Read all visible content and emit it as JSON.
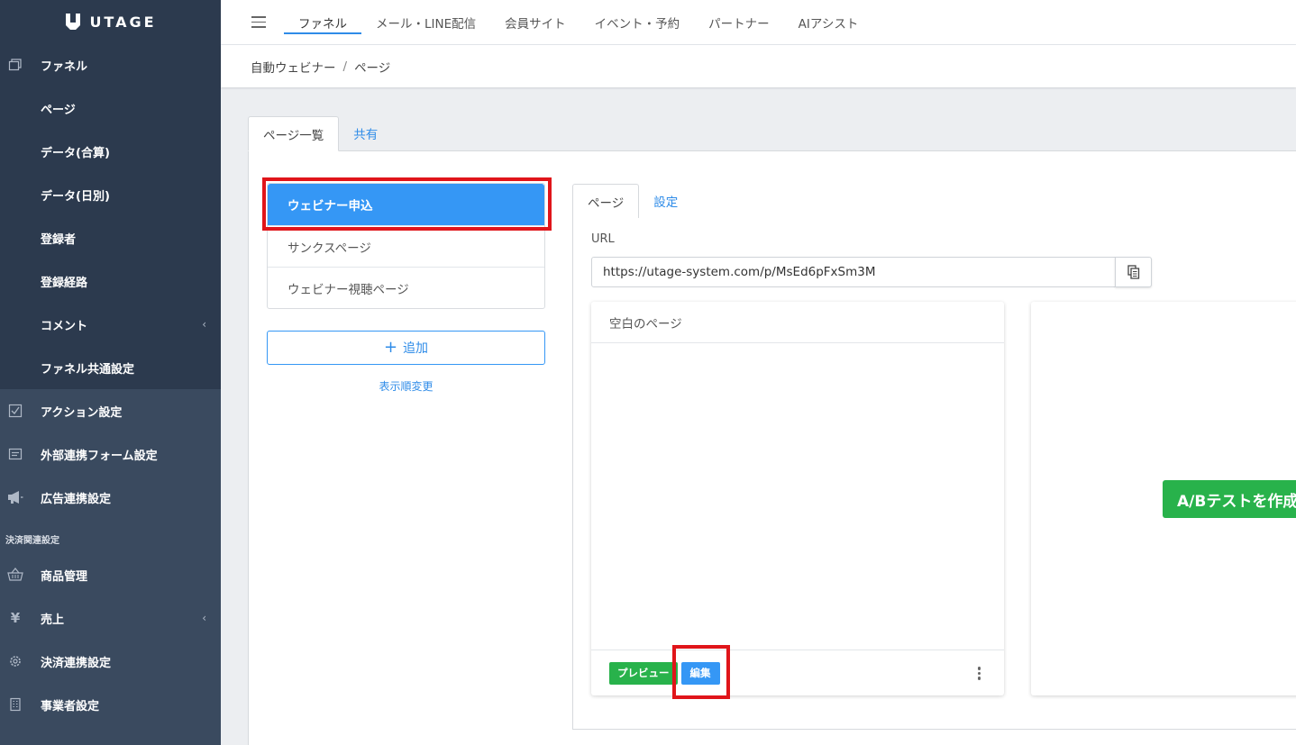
{
  "brand": {
    "name": "UTAGE"
  },
  "sidebar": {
    "funnel_items": [
      {
        "label": "ファネル",
        "icon": "funnel-icon"
      },
      {
        "label": "ページ"
      },
      {
        "label": "データ(合算)"
      },
      {
        "label": "データ(日別)"
      },
      {
        "label": "登録者"
      },
      {
        "label": "登録経路"
      },
      {
        "label": "コメント",
        "chevron": "‹"
      },
      {
        "label": "ファネル共通設定"
      }
    ],
    "items": [
      {
        "label": "アクション設定",
        "icon": "checklist-icon"
      },
      {
        "label": "外部連携フォーム設定",
        "icon": "form-icon"
      },
      {
        "label": "広告連携設定",
        "icon": "megaphone-icon"
      }
    ],
    "section_payment": "決済関連設定",
    "payment_items": [
      {
        "label": "商品管理",
        "icon": "basket-icon"
      },
      {
        "label": "売上",
        "icon": "yen-icon",
        "chevron": "‹"
      },
      {
        "label": "決済連携設定",
        "icon": "gear-icon"
      },
      {
        "label": "事業者設定",
        "icon": "building-icon"
      }
    ]
  },
  "topnav": {
    "items": [
      {
        "label": "ファネル",
        "active": true
      },
      {
        "label": "メール・LINE配信"
      },
      {
        "label": "会員サイト"
      },
      {
        "label": "イベント・予約"
      },
      {
        "label": "パートナー"
      },
      {
        "label": "AIアシスト"
      }
    ]
  },
  "breadcrumb": {
    "parent": "自動ウェビナー",
    "sep": "/",
    "current": "ページ"
  },
  "main_tabs": [
    {
      "label": "ページ一覧",
      "active": true
    },
    {
      "label": "共有"
    }
  ],
  "page_list": {
    "items": [
      {
        "label": "ウェビナー申込",
        "active": true
      },
      {
        "label": "サンクスページ"
      },
      {
        "label": "ウェビナー視聴ページ"
      }
    ],
    "add_label": "追加",
    "reorder_label": "表示順変更"
  },
  "page_tabs": [
    {
      "label": "ページ",
      "active": true
    },
    {
      "label": "設定"
    }
  ],
  "url": {
    "label": "URL",
    "value": "https://utage-system.com/p/MsEd6pFxSm3M"
  },
  "card": {
    "title": "空白のページ",
    "preview_label": "プレビュー",
    "edit_label": "編集"
  },
  "ab_test": {
    "label": "A/Bテストを作成"
  },
  "colors": {
    "primary": "#3597f5",
    "success": "#28b24b",
    "sidebar": "#3a4a5f",
    "highlight": "#e0151a"
  }
}
